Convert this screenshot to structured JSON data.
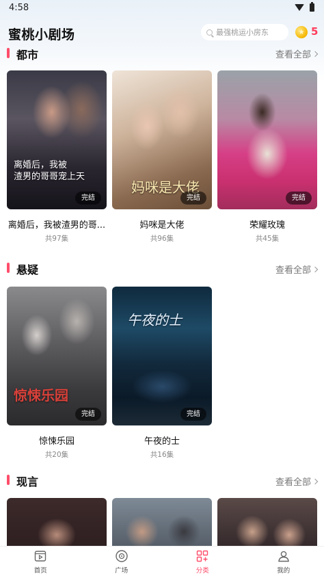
{
  "status_bar": {
    "time": "4:58"
  },
  "header": {
    "title": "蜜桃小剧场",
    "search_placeholder": "最强桃运小房东",
    "coin_count": "5"
  },
  "colors": {
    "accent": "#ff4d6a",
    "coin": "#f5b700"
  },
  "sections": [
    {
      "title": "都市",
      "view_all": "查看全部",
      "items": [
        {
          "title": "离婚后，我被渣男的哥...",
          "episodes": "共97集",
          "badge": "完结",
          "poster_text": "离婚后，我被\n渣男的哥哥宠上天"
        },
        {
          "title": "妈咪是大佬",
          "episodes": "共96集",
          "badge": "完结",
          "poster_text": "妈咪是大佬"
        },
        {
          "title": "荣耀玫瑰",
          "episodes": "共45集",
          "badge": "完结",
          "poster_text": ""
        }
      ]
    },
    {
      "title": "悬疑",
      "view_all": "查看全部",
      "items": [
        {
          "title": "惊悚乐园",
          "episodes": "共20集",
          "badge": "完结",
          "poster_text": "惊悚乐园"
        },
        {
          "title": "午夜的士",
          "episodes": "共16集",
          "badge": "完结",
          "poster_text": "午夜的士"
        }
      ]
    },
    {
      "title": "现言",
      "view_all": "查看全部",
      "items": []
    }
  ],
  "bottom_nav": [
    {
      "label": "首页",
      "icon": "home-icon"
    },
    {
      "label": "广场",
      "icon": "disc-icon"
    },
    {
      "label": "分类",
      "icon": "category-icon",
      "active": true
    },
    {
      "label": "我的",
      "icon": "user-icon"
    }
  ]
}
